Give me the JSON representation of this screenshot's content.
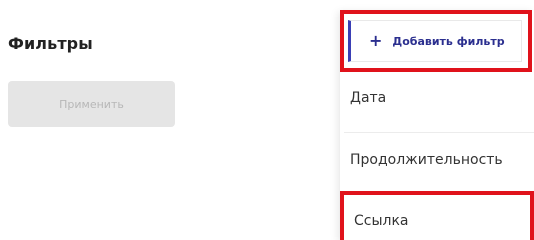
{
  "filters": {
    "title": "Фильтры",
    "apply_label": "Применить"
  },
  "dropdown": {
    "add_filter_label": "Добавить фильтр",
    "items": [
      {
        "label": "Дата"
      },
      {
        "label": "Продолжительность"
      },
      {
        "label": "Ссылка"
      }
    ]
  },
  "colors": {
    "highlight_border": "#e0121b",
    "accent": "#2b2f8f",
    "disabled_button_bg": "#e5e5e5",
    "disabled_button_text": "#b7b7b7"
  },
  "icons": {
    "add": "plus-icon"
  }
}
